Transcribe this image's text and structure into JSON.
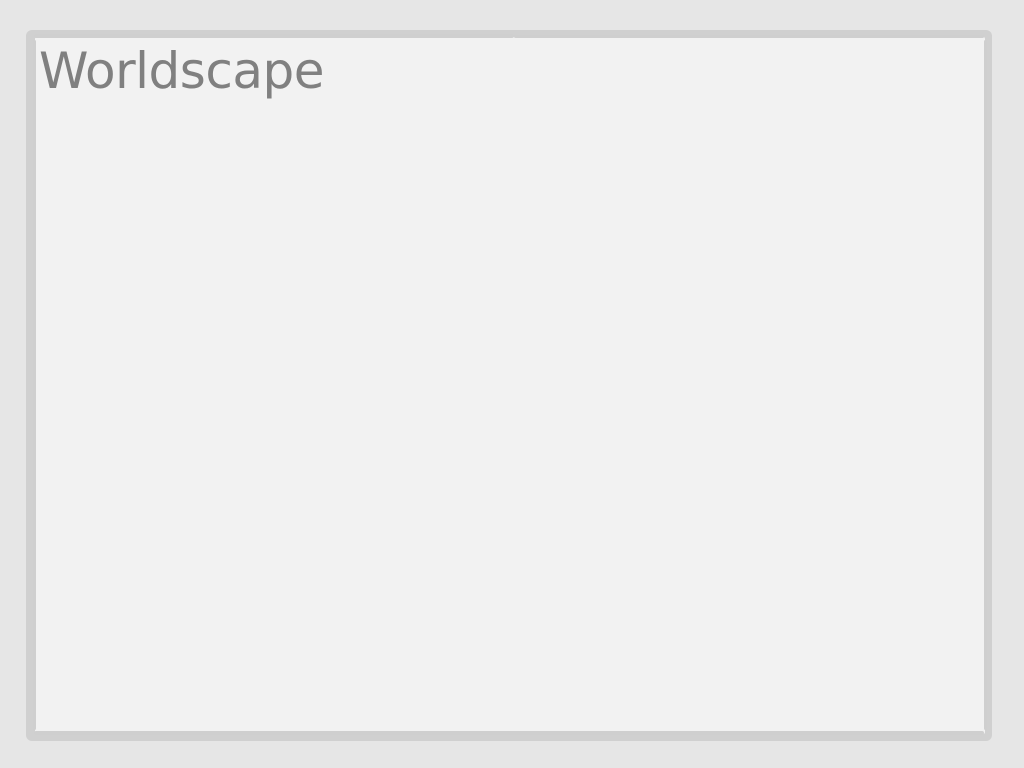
{
  "window": {
    "title": "Worldscape"
  },
  "colors": {
    "background": "#e6e6e6",
    "frame": "#d0d0d0",
    "panel": "#f2f2f2",
    "title_text": "#808080"
  }
}
